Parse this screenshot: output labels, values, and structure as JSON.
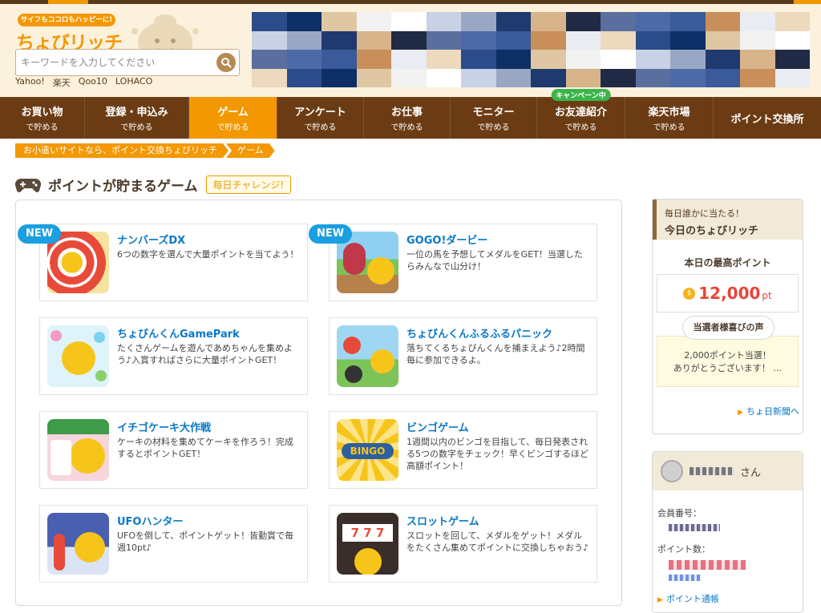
{
  "logo": {
    "tagline": "サイフもココロもハッピーに!",
    "name": "ちょびリッチ"
  },
  "search": {
    "placeholder": "キーワードを入力してください",
    "value": ""
  },
  "quick_links": [
    "Yahoo!",
    "楽天",
    "Qoo10",
    "LOHACO"
  ],
  "nav": [
    {
      "main": "お買い物",
      "sub": "で貯める",
      "active": false
    },
    {
      "main": "登録・申込み",
      "sub": "で貯める",
      "active": false
    },
    {
      "main": "ゲーム",
      "sub": "で貯める",
      "active": true
    },
    {
      "main": "アンケート",
      "sub": "で貯める",
      "active": false
    },
    {
      "main": "お仕事",
      "sub": "で貯める",
      "active": false
    },
    {
      "main": "モニター",
      "sub": "で貯める",
      "active": false
    },
    {
      "main": "お友達紹介",
      "sub": "で貯める",
      "active": false,
      "badge": "キャンペーン中"
    },
    {
      "main": "楽天市場",
      "sub": "で貯める",
      "active": false
    },
    {
      "main": "ポイント交換所",
      "sub": "",
      "active": false
    }
  ],
  "breadcrumb": [
    "お小遣いサイトなら、ポイント交換ちょびリッチ",
    "ゲーム"
  ],
  "section": {
    "title": "ポイントが貯まるゲーム",
    "badge": "毎日チャレンジ!"
  },
  "games": [
    {
      "title": "ナンバーズDX",
      "desc": "6つの数字を選んで大量ポイントを当てよう！",
      "new": true,
      "new_label": "NEW"
    },
    {
      "title": "GOGO!ダービー",
      "desc": "一位の馬を予想してメダルをGET！当選したらみんなで山分け！",
      "new": true,
      "new_label": "NEW"
    },
    {
      "title": "ちょびんくんGamePark",
      "desc": "たくさんゲームを遊んであめちゃんを集めよう♪入賞すればさらに大量ポイントGET！",
      "new": false
    },
    {
      "title": "ちょびんくんふるふるパニック",
      "desc": "落ちてくるちょびんくんを捕まえよう♪2時間毎に参加できるよ。",
      "new": false
    },
    {
      "title": "イチゴケーキ大作戦",
      "desc": "ケーキの材料を集めてケーキを作ろう！完成するとポイントGET！",
      "new": false
    },
    {
      "title": "ビンゴゲーム",
      "desc": "1週間以内のビンゴを目指して、毎日発表される5つの数字をチェック！早くビンゴするほど高額ポイント！",
      "new": false
    },
    {
      "title": "UFOハンター",
      "desc": "UFOを倒して、ポイントゲット！皆勤賞で毎週10pt♪",
      "new": false
    },
    {
      "title": "スロットゲーム",
      "desc": "スロットを回して、メダルをゲット！メダルをたくさん集めてポイントに交換しちゃおう♪",
      "new": false
    }
  ],
  "lucky": {
    "kicker": "毎日誰かに当たる！",
    "title": "今日のちょびリッチ",
    "max_label": "本日の最高ポイント",
    "points": "12,000",
    "unit": "pt",
    "voice_tab": "当選者様喜びの声",
    "voice_line1": "2,000ポイント当選！",
    "voice_line2": "ありがとうございます！ …",
    "newspaper_link": "ちょ日新聞へ"
  },
  "user": {
    "suffix": "さん",
    "member_label": "会員番号：",
    "points_label": "ポイント数：",
    "passbook_link": "ポイント通帳"
  },
  "colors": {
    "brown": "#6b3c14",
    "orange": "#f39800",
    "link_blue": "#0a78c8",
    "new_blue": "#1a9fe0"
  }
}
